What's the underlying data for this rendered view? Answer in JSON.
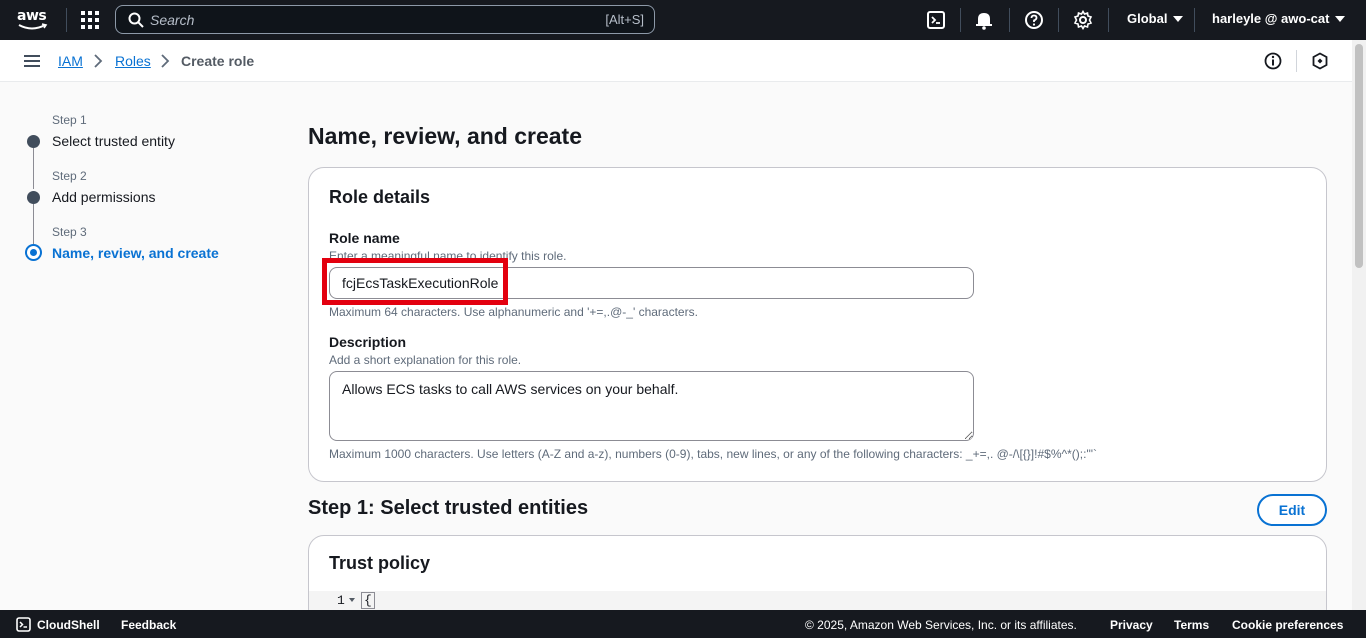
{
  "topnav": {
    "logo_text": "aws",
    "search_placeholder": "Search",
    "search_shortcut": "[Alt+S]",
    "region": "Global",
    "user": "harleyle @ awo-cat"
  },
  "breadcrumb": {
    "items": [
      "IAM",
      "Roles",
      "Create role"
    ]
  },
  "steps": [
    {
      "num": "Step 1",
      "label": "Select trusted entity"
    },
    {
      "num": "Step 2",
      "label": "Add permissions"
    },
    {
      "num": "Step 3",
      "label": "Name, review, and create"
    }
  ],
  "page_title": "Name, review, and create",
  "role_details": {
    "title": "Role details",
    "role_name": {
      "label": "Role name",
      "description": "Enter a meaningful name to identify this role.",
      "value": "fcjEcsTaskExecutionRole",
      "constraint": "Maximum 64 characters. Use alphanumeric and '+=,.@-_' characters."
    },
    "description": {
      "label": "Description",
      "description": "Add a short explanation for this role.",
      "value": "Allows ECS tasks to call AWS services on your behalf.",
      "constraint": "Maximum 1000 characters. Use letters (A-Z and a-z), numbers (0-9), tabs, new lines, or any of the following characters: _+=,. @-/\\[{}]!#$%^*();:\"'`"
    }
  },
  "step1_section": {
    "title": "Step 1: Select trusted entities",
    "edit_label": "Edit",
    "trust_policy_title": "Trust policy",
    "code_line_number": "1",
    "code_first_line": "{"
  },
  "footer": {
    "cloudshell": "CloudShell",
    "feedback": "Feedback",
    "copyright": "© 2025, Amazon Web Services, Inc. or its affiliates.",
    "privacy": "Privacy",
    "terms": "Terms",
    "cookie": "Cookie preferences"
  },
  "colors": {
    "nav_bg": "#16191f",
    "link": "#0972d3",
    "highlight": "#e3000f"
  }
}
